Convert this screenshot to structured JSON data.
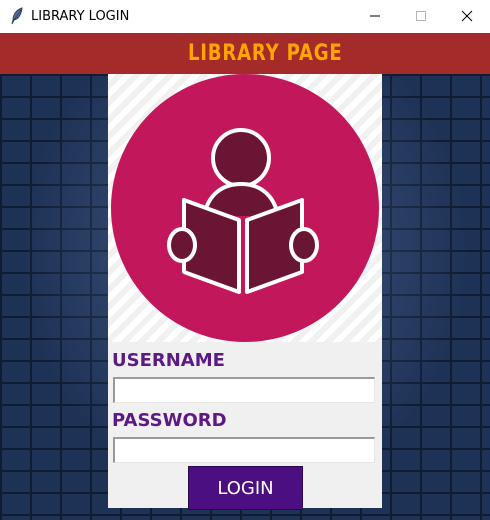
{
  "window": {
    "title": "LIBRARY LOGIN",
    "app_icon": "feather-icon",
    "controls": [
      "minimize-icon",
      "maximize-icon",
      "close-icon"
    ]
  },
  "header": {
    "title": "LIBRARY PAGE"
  },
  "logo": {
    "icon": "reader-icon"
  },
  "form": {
    "username_label": "USERNAME",
    "username_value": "",
    "password_label": "PASSWORD",
    "password_value": "",
    "login_label": "LOGIN"
  },
  "colors": {
    "banner_bg": "#a52a2a",
    "banner_text": "#ffa500",
    "label_text": "#5b1a84",
    "button_bg": "#4b0f82",
    "logo_circle": "#c2185b",
    "logo_figure": "#6b1535"
  }
}
